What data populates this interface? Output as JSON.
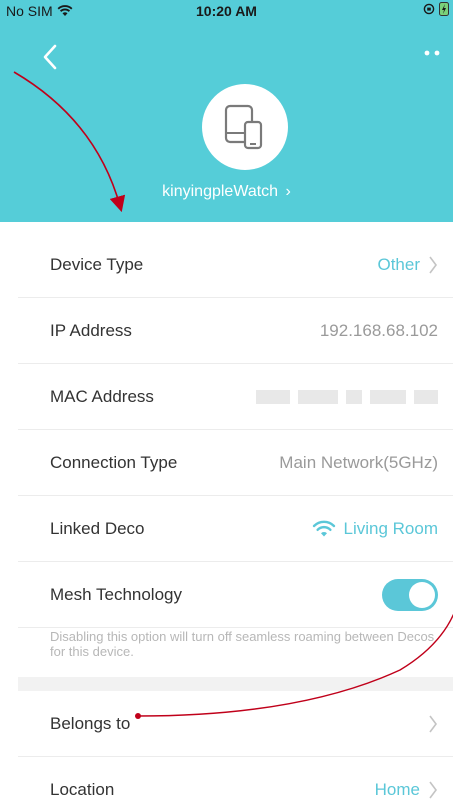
{
  "status_bar": {
    "carrier": "No SIM",
    "time": "10:20 AM"
  },
  "header": {
    "device_name": "kinyingpleWatch",
    "name_chevron": "›"
  },
  "details": {
    "device_type": {
      "label": "Device Type",
      "value": "Other"
    },
    "ip_address": {
      "label": "IP Address",
      "value": "192.168.68.102"
    },
    "mac_address": {
      "label": "MAC Address",
      "value": ""
    },
    "connection_type": {
      "label": "Connection Type",
      "value": "Main Network(5GHz)"
    },
    "linked_deco": {
      "label": "Linked Deco",
      "value": "Living Room"
    },
    "mesh_technology": {
      "label": "Mesh Technology",
      "enabled": true
    },
    "mesh_note": "Disabling this option will turn off seamless roaming between Decos for this device."
  },
  "more": {
    "belongs_to": {
      "label": "Belongs to",
      "value": ""
    },
    "location": {
      "label": "Location",
      "value": "Home"
    }
  },
  "colors": {
    "header_bg": "#55cdd8",
    "accent": "#5bc7d8",
    "annotation": "#c0001a"
  },
  "icons": {
    "back": "chevron-left-icon",
    "more": "more-dots-icon",
    "device": "devices-icon",
    "wifi": "wifi-icon"
  }
}
